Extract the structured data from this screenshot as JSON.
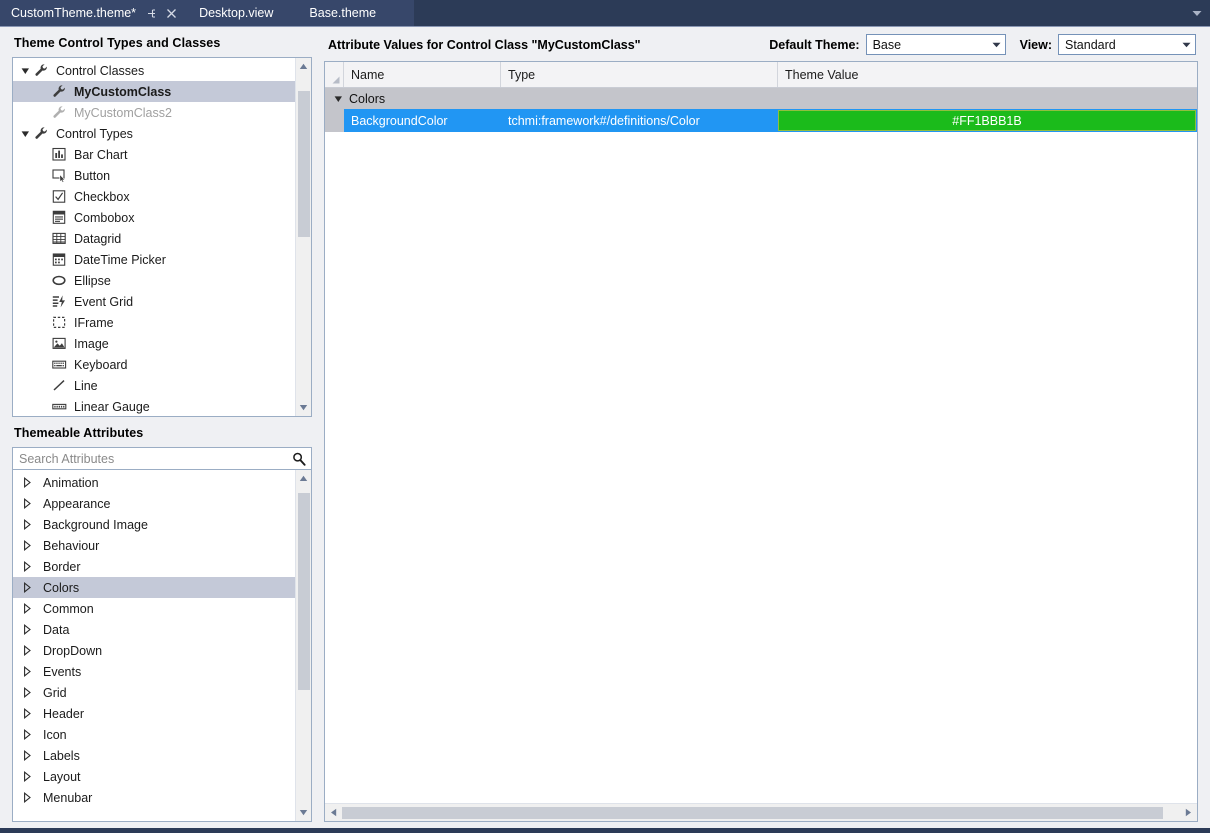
{
  "window": {
    "tabs": [
      {
        "label": "CustomTheme.theme*",
        "state": "active",
        "icons": [
          "pin-icon",
          "close-icon"
        ]
      },
      {
        "label": "Desktop.view",
        "state": "inactive",
        "icons": []
      },
      {
        "label": "Base.theme",
        "state": "inactive",
        "icons": []
      }
    ],
    "overflow_icon": "chevron-down-icon"
  },
  "left": {
    "tree_panel": {
      "title": "Theme Control Types and Classes",
      "nodes": [
        {
          "label": "Control Classes",
          "level": 1,
          "icon": "wrench-icon",
          "expander": "expanded",
          "state": "normal"
        },
        {
          "label": "MyCustomClass",
          "level": 2,
          "icon": "wrench-icon",
          "expander": "none",
          "state": "selected"
        },
        {
          "label": "MyCustomClass2",
          "level": 2,
          "icon": "wrench-icon",
          "expander": "none",
          "state": "disabled"
        },
        {
          "label": "Control Types",
          "level": 1,
          "icon": "wrench-icon",
          "expander": "expanded",
          "state": "normal"
        },
        {
          "label": "Bar Chart",
          "level": 2,
          "icon": "bar-chart-icon",
          "expander": "none",
          "state": "normal"
        },
        {
          "label": "Button",
          "level": 2,
          "icon": "button-icon",
          "expander": "none",
          "state": "normal"
        },
        {
          "label": "Checkbox",
          "level": 2,
          "icon": "checkbox-icon",
          "expander": "none",
          "state": "normal"
        },
        {
          "label": "Combobox",
          "level": 2,
          "icon": "combobox-icon",
          "expander": "none",
          "state": "normal"
        },
        {
          "label": "Datagrid",
          "level": 2,
          "icon": "datagrid-icon",
          "expander": "none",
          "state": "normal"
        },
        {
          "label": "DateTime Picker",
          "level": 2,
          "icon": "datetime-picker-icon",
          "expander": "none",
          "state": "normal"
        },
        {
          "label": "Ellipse",
          "level": 2,
          "icon": "ellipse-icon",
          "expander": "none",
          "state": "normal"
        },
        {
          "label": "Event Grid",
          "level": 2,
          "icon": "event-grid-icon",
          "expander": "none",
          "state": "normal"
        },
        {
          "label": "IFrame",
          "level": 2,
          "icon": "iframe-icon",
          "expander": "none",
          "state": "normal"
        },
        {
          "label": "Image",
          "level": 2,
          "icon": "image-icon",
          "expander": "none",
          "state": "normal"
        },
        {
          "label": "Keyboard",
          "level": 2,
          "icon": "keyboard-icon",
          "expander": "none",
          "state": "normal"
        },
        {
          "label": "Line",
          "level": 2,
          "icon": "line-icon",
          "expander": "none",
          "state": "normal"
        },
        {
          "label": "Linear Gauge",
          "level": 2,
          "icon": "linear-gauge-icon",
          "expander": "none",
          "state": "normal"
        }
      ],
      "scroll": {
        "thumb_top_pct": 5,
        "thumb_height_pct": 45
      }
    },
    "attr_panel": {
      "title": "Themeable Attributes",
      "search": {
        "placeholder": "Search Attributes",
        "value": "",
        "icon": "search-icon"
      },
      "items": [
        {
          "label": "Animation",
          "state": "normal"
        },
        {
          "label": "Appearance",
          "state": "normal"
        },
        {
          "label": "Background Image",
          "state": "normal"
        },
        {
          "label": "Behaviour",
          "state": "normal"
        },
        {
          "label": "Border",
          "state": "normal"
        },
        {
          "label": "Colors",
          "state": "selected"
        },
        {
          "label": "Common",
          "state": "normal"
        },
        {
          "label": "Data",
          "state": "normal"
        },
        {
          "label": "DropDown",
          "state": "normal"
        },
        {
          "label": "Events",
          "state": "normal"
        },
        {
          "label": "Grid",
          "state": "normal"
        },
        {
          "label": "Header",
          "state": "normal"
        },
        {
          "label": "Icon",
          "state": "normal"
        },
        {
          "label": "Labels",
          "state": "normal"
        },
        {
          "label": "Layout",
          "state": "normal"
        },
        {
          "label": "Menubar",
          "state": "normal"
        }
      ],
      "scroll": {
        "thumb_top_pct": 2,
        "thumb_height_pct": 62
      }
    }
  },
  "right": {
    "title": "Attribute Values for Control Class \"MyCustomClass\"",
    "default_theme": {
      "label": "Default Theme:",
      "value": "Base"
    },
    "view": {
      "label": "View:",
      "value": "Standard"
    },
    "grid": {
      "columns": [
        "Name",
        "Type",
        "Theme Value"
      ],
      "groups": [
        {
          "label": "Colors",
          "expanded": true,
          "rows": [
            {
              "name": "BackgroundColor",
              "type": "tchmi:framework#/definitions/Color",
              "value": "#FF1BBB1B",
              "value_color": "#1BBB1B",
              "selected": true
            }
          ]
        }
      ],
      "hscroll": {
        "thumb_left_pct": 0,
        "thumb_width_pct": 98
      }
    }
  },
  "colors": {
    "chrome": "#2c3b57",
    "tab_active": "#37476a",
    "panel_bg": "#eff0f3",
    "selection": "#c4c9d8",
    "row_selected": "#2196f3",
    "group_row": "#c4c5cb",
    "swatch": "#1BBB1B"
  }
}
